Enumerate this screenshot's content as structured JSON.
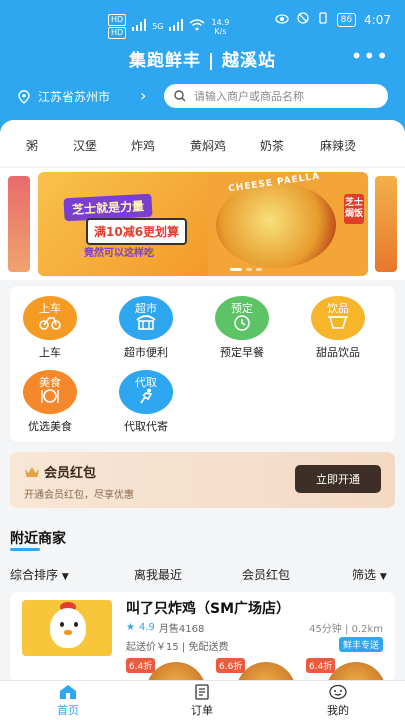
{
  "status": {
    "net_tags": [
      "HD",
      "HD"
    ],
    "signal": "5G",
    "speed_value": "14.9",
    "speed_unit": "K/s",
    "battery": "86",
    "time": "4:07"
  },
  "header": {
    "title": "集跑鲜丰 | 越溪站",
    "more": "•••",
    "location": "江苏省苏州市",
    "location_arrow": "›",
    "search_placeholder": "请输入商户或商品名称"
  },
  "categories": [
    "粥",
    "汉堡",
    "炸鸡",
    "黄焖鸡",
    "奶茶",
    "麻辣烫"
  ],
  "banner": {
    "tag1": "芝士就是力量",
    "tag2": "满10减6更划算",
    "tag3": "竟然可以这样吃",
    "dish_text": "CHEESE PAELLA",
    "vertical_text": "芝士焗饭"
  },
  "shortcuts": [
    {
      "label": "上车",
      "circle_text": "上车",
      "color": "#f59a22"
    },
    {
      "label": "超市便利",
      "circle_text": "超市",
      "color": "#2ea6f0"
    },
    {
      "label": "预定早餐",
      "circle_text": "预定",
      "color": "#5cc466"
    },
    {
      "label": "甜品饮品",
      "circle_text": "饮品",
      "color": "#f7b52c"
    },
    {
      "label": "优选美食",
      "circle_text": "美食",
      "color": "#f5882a"
    },
    {
      "label": "代取代寄",
      "circle_text": "代取",
      "color": "#2ea6f0"
    }
  ],
  "vip": {
    "title": "会员红包",
    "subtitle": "开通会员红包，尽享优惠",
    "button": "立即开通"
  },
  "nearby": {
    "title": "附近商家",
    "sorts": [
      "综合排序",
      "离我最近",
      "会员红包",
      "筛选"
    ]
  },
  "shop": {
    "name": "叫了只炸鸡（SM广场店）",
    "rating": "4.9",
    "monthly_sales": "月售4168",
    "time": "45分钟",
    "distance": "0.2km",
    "fee": "起送价￥15 | 免配送费",
    "badge": "鲜丰专送",
    "discounts": [
      "6.4折",
      "6.6折",
      "6.4折"
    ]
  },
  "tabs": [
    {
      "label": "首页",
      "active": true
    },
    {
      "label": "订单",
      "active": false
    },
    {
      "label": "我的",
      "active": false
    }
  ],
  "colors": {
    "primary": "#2ea6f0",
    "background": "#f4f5f7",
    "vip_button": "#3d2f25"
  }
}
